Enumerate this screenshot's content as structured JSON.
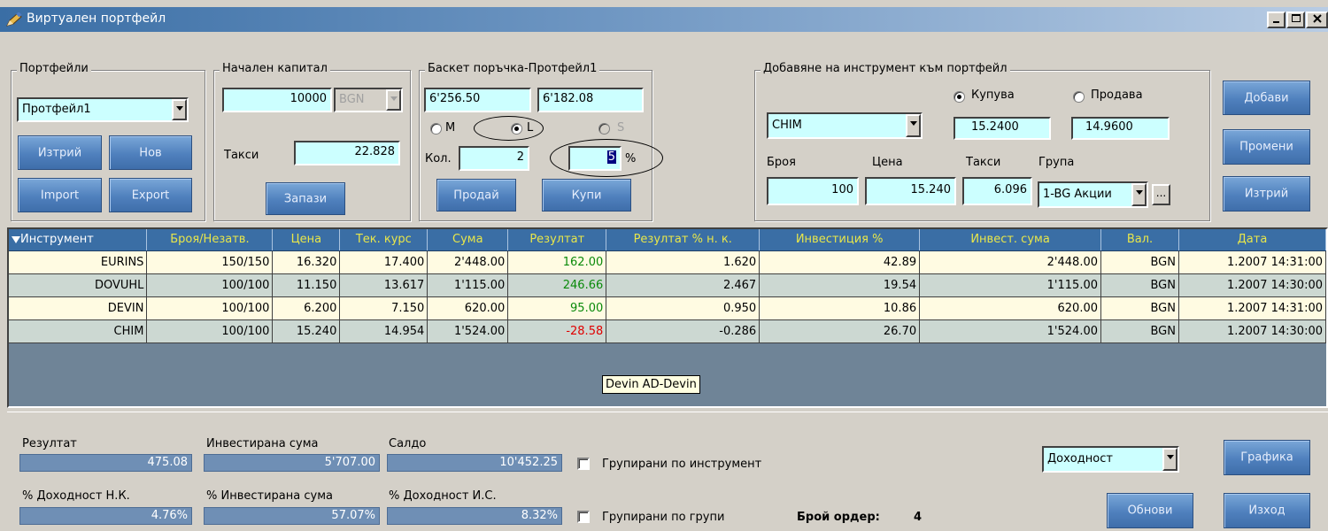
{
  "window": {
    "title": "Виртуален портфейл"
  },
  "portfolios": {
    "legend": "Портфейли",
    "selected": "Протфейл1",
    "delete_label": "Изтрий",
    "new_label": "Нов",
    "import_label": "Import",
    "export_label": "Export"
  },
  "capital": {
    "legend": "Начален капитал",
    "amount": "10000",
    "currency": "BGN",
    "fees_label": "Такси",
    "fees_value": "22.828",
    "save_label": "Запази"
  },
  "basket": {
    "legend": "Баскет поръчка-Протфейл1",
    "value1": "6'256.50",
    "value2": "6'182.08",
    "radio_m": "M",
    "radio_l": "L",
    "radio_s": "S",
    "qty_label": "Кол.",
    "qty_value": "2",
    "percent_value": "5",
    "percent_sign": "%",
    "sell_label": "Продай",
    "buy_label": "Купи"
  },
  "add_instrument": {
    "legend": "Добавяне на инструмент към портфейл",
    "buy_radio": "Купува",
    "sell_radio": "Продава",
    "instrument": "CHIM",
    "buy_price": "15.2400",
    "sell_price": "14.9600",
    "count_label": "Броя",
    "price_label": "Цена",
    "fees_label": "Такси",
    "group_label": "Група",
    "count_value": "100",
    "price_value": "15.240",
    "fees_value": "6.096",
    "group_value": "1-BG Акции",
    "ellipsis": "...",
    "add_label": "Добави",
    "edit_label": "Промени",
    "delete_label": "Изтрий"
  },
  "grid": {
    "columns": [
      "Инструмент",
      "Броя/Незатв.",
      "Цена",
      "Тек. курс",
      "Сума",
      "Резултат",
      "Резултат % н. к.",
      "Инвестиция %",
      "Инвест. сума",
      "Вал.",
      "Дата"
    ],
    "rows": [
      [
        "EURINS",
        "150/150",
        "16.320",
        "17.400",
        "2'448.00",
        "162.00",
        "1.620",
        "42.89",
        "2'448.00",
        "BGN",
        "1.2007 14:31:00"
      ],
      [
        "DOVUHL",
        "100/100",
        "11.150",
        "13.617",
        "1'115.00",
        "246.66",
        "2.467",
        "19.54",
        "1'115.00",
        "BGN",
        "1.2007 14:30:00"
      ],
      [
        "DEVIN",
        "100/100",
        "6.200",
        "7.150",
        "620.00",
        "95.00",
        "0.950",
        "10.86",
        "620.00",
        "BGN",
        "1.2007 14:31:00"
      ],
      [
        "CHIM",
        "100/100",
        "15.240",
        "14.954",
        "1'524.00",
        "-28.58",
        "-0.286",
        "26.70",
        "1'524.00",
        "BGN",
        "1.2007 14:30:00"
      ]
    ],
    "tooltip": "Devin AD-Devin"
  },
  "summary": {
    "result_label": "Резултат",
    "result_value": "475.08",
    "invested_label": "Инвестирана сума",
    "invested_value": "5'707.00",
    "balance_label": "Салдо",
    "balance_value": "10'452.25",
    "yield_nk_label": "% Доходност Н.К.",
    "yield_nk_value": "4.76%",
    "invested_pct_label": "% Инвестирана сума",
    "invested_pct_value": "57.07%",
    "yield_is_label": "% Доходност И.С.",
    "yield_is_value": "8.32%",
    "group_by_instrument": "Групирани по инструмент",
    "group_by_groups": "Групирани по групи",
    "order_count_label": "Брой ордер:",
    "order_count_value": "4",
    "chart_type": "Доходност",
    "chart_label": "Графика",
    "refresh_label": "Обнови",
    "exit_label": "Изход"
  }
}
